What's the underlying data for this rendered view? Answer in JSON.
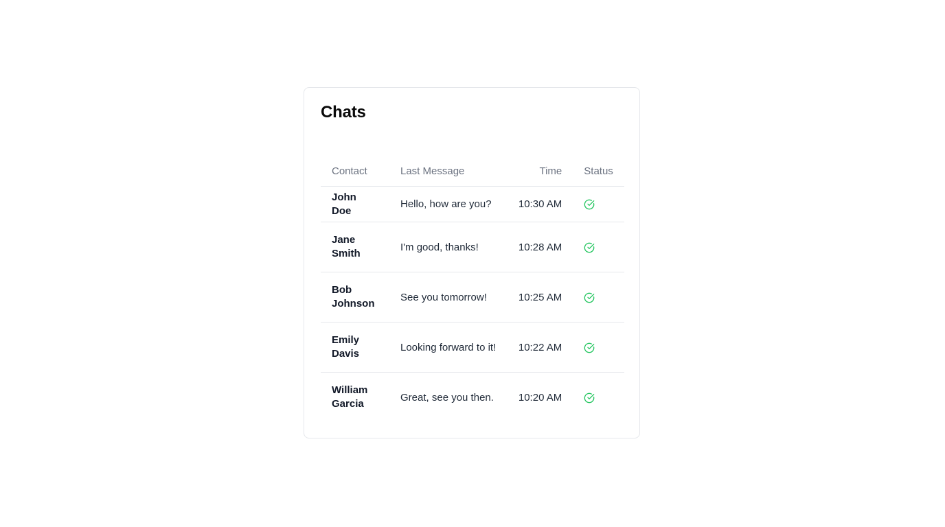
{
  "title": "Chats",
  "columns": {
    "contact": "Contact",
    "message": "Last Message",
    "time": "Time",
    "status": "Status"
  },
  "status_color": "#22c55e",
  "rows": [
    {
      "contact": "John Doe",
      "message": "Hello, how are you?",
      "time": "10:30 AM",
      "status_icon": "check-circle-icon"
    },
    {
      "contact": "Jane Smith",
      "message": "I'm good, thanks!",
      "time": "10:28 AM",
      "status_icon": "check-circle-icon"
    },
    {
      "contact": "Bob Johnson",
      "message": "See you tomorrow!",
      "time": "10:25 AM",
      "status_icon": "check-circle-icon"
    },
    {
      "contact": "Emily Davis",
      "message": "Looking forward to it!",
      "time": "10:22 AM",
      "status_icon": "check-circle-icon"
    },
    {
      "contact": "William Garcia",
      "message": "Great, see you then.",
      "time": "10:20 AM",
      "status_icon": "check-circle-icon"
    }
  ]
}
